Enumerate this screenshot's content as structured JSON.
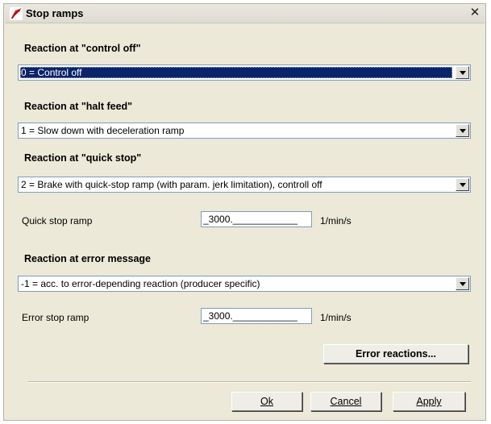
{
  "window": {
    "title": "Stop ramps",
    "close_glyph": "✕"
  },
  "sections": {
    "control_off": {
      "label": "Reaction at \"control off\"",
      "value": "0 = Control off"
    },
    "halt_feed": {
      "label": "Reaction at \"halt feed\"",
      "value": "1 = Slow down with deceleration ramp"
    },
    "quick_stop": {
      "label": "Reaction at \"quick stop\"",
      "value": "2 = Brake with quick-stop ramp (with param. jerk limitation), controll off",
      "ramp_label": "Quick stop ramp",
      "ramp_value": "_3000.____________",
      "ramp_unit": "1/min/s"
    },
    "error_message": {
      "label": "Reaction at error message",
      "value": "-1 = acc. to error-depending reaction (producer specific)",
      "ramp_label": "Error stop ramp",
      "ramp_value": "_3000.____________",
      "ramp_unit": "1/min/s"
    }
  },
  "buttons": {
    "error_reactions": "Error reactions...",
    "ok": "Ok",
    "cancel": "Cancel",
    "apply": "Apply"
  },
  "colors": {
    "dialog_bg": "#ece9d8",
    "selection_bg": "#0a246a",
    "input_border": "#7f9db9"
  },
  "icons": {
    "app": "app-logo-icon",
    "close": "close-icon",
    "dropdown": "chevron-down-icon"
  }
}
